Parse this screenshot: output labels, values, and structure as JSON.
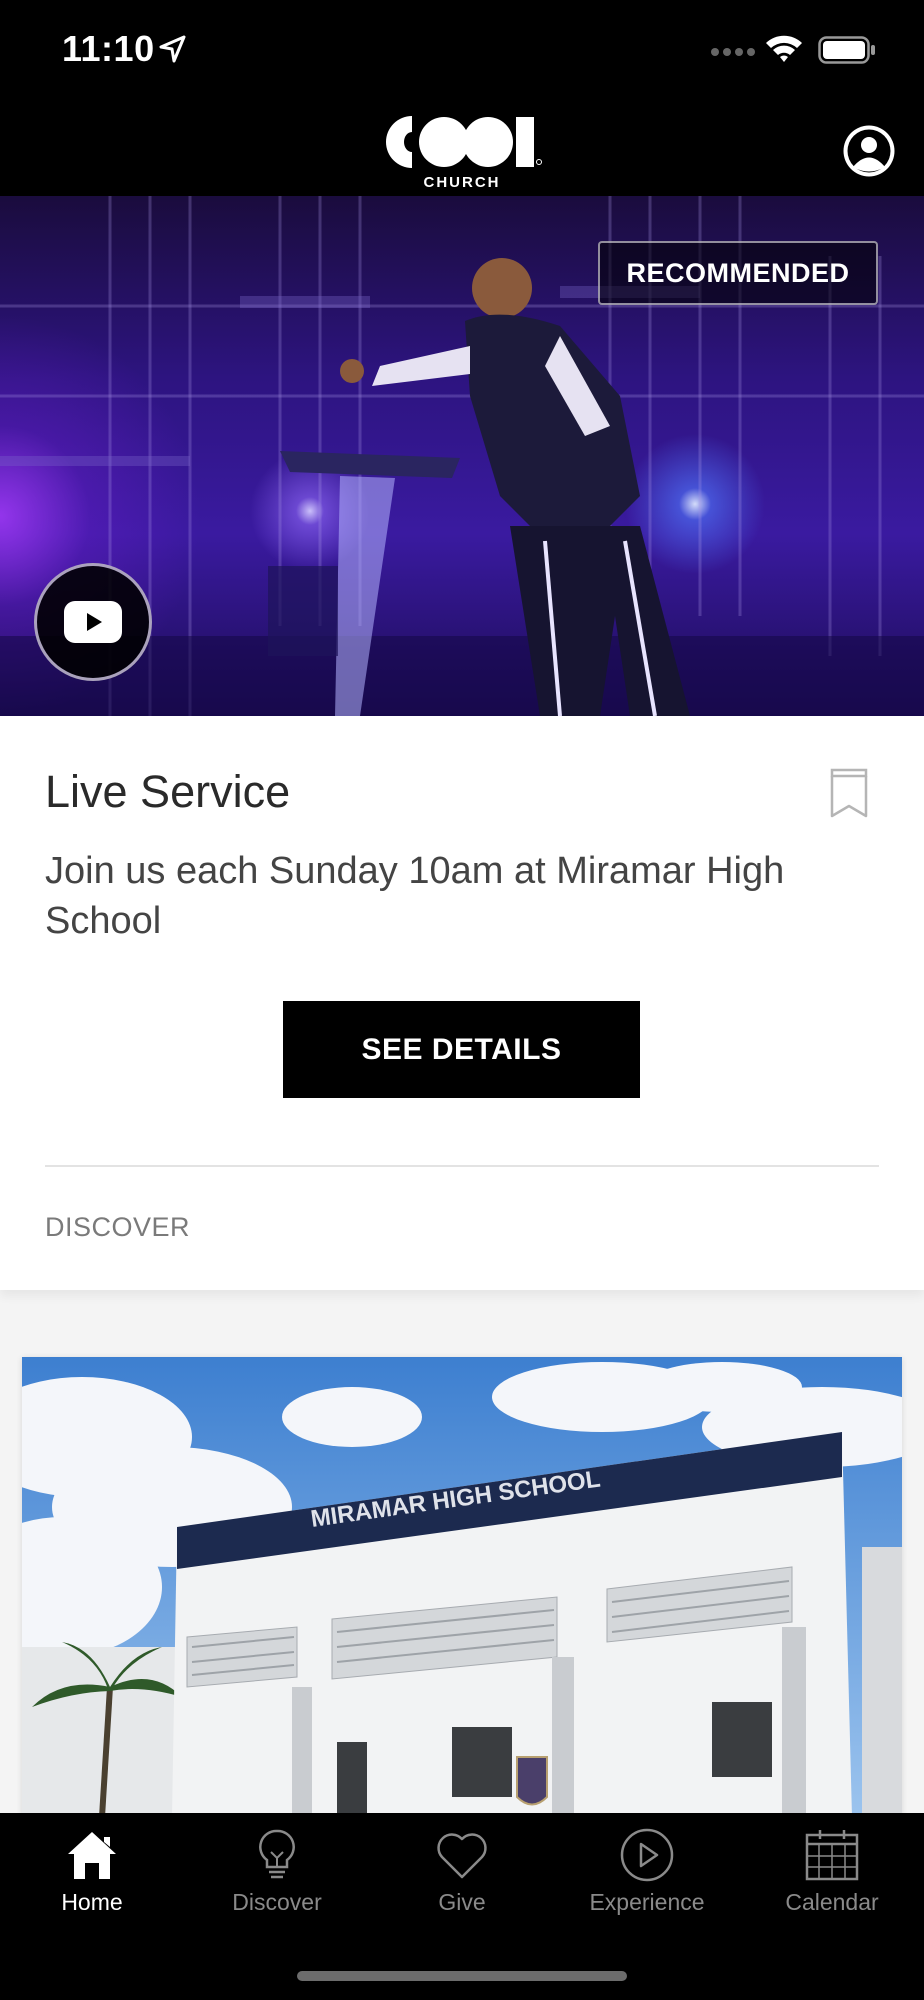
{
  "status_bar": {
    "time": "11:10"
  },
  "header": {
    "logo_word": "COOL",
    "logo_sub": "CHURCH"
  },
  "hero": {
    "badge": "RECOMMENDED"
  },
  "card": {
    "title": "Live Service",
    "description": "Join us each Sunday 10am at Miramar High School",
    "button_label": "SEE DETAILS",
    "section_label": "DISCOVER"
  },
  "discover_card": {
    "building_sign": "MIRAMAR HIGH SCHOOL"
  },
  "tabs": [
    {
      "label": "Home",
      "icon": "home-icon",
      "active": true
    },
    {
      "label": "Discover",
      "icon": "lightbulb-icon",
      "active": false
    },
    {
      "label": "Give",
      "icon": "heart-icon",
      "active": false
    },
    {
      "label": "Experience",
      "icon": "play-circle-icon",
      "active": false
    },
    {
      "label": "Calendar",
      "icon": "calendar-icon",
      "active": false
    }
  ],
  "colors": {
    "header_bg": "#000000",
    "button_bg": "#000000",
    "tab_active": "#ffffff",
    "tab_inactive": "#8a8a8a"
  }
}
